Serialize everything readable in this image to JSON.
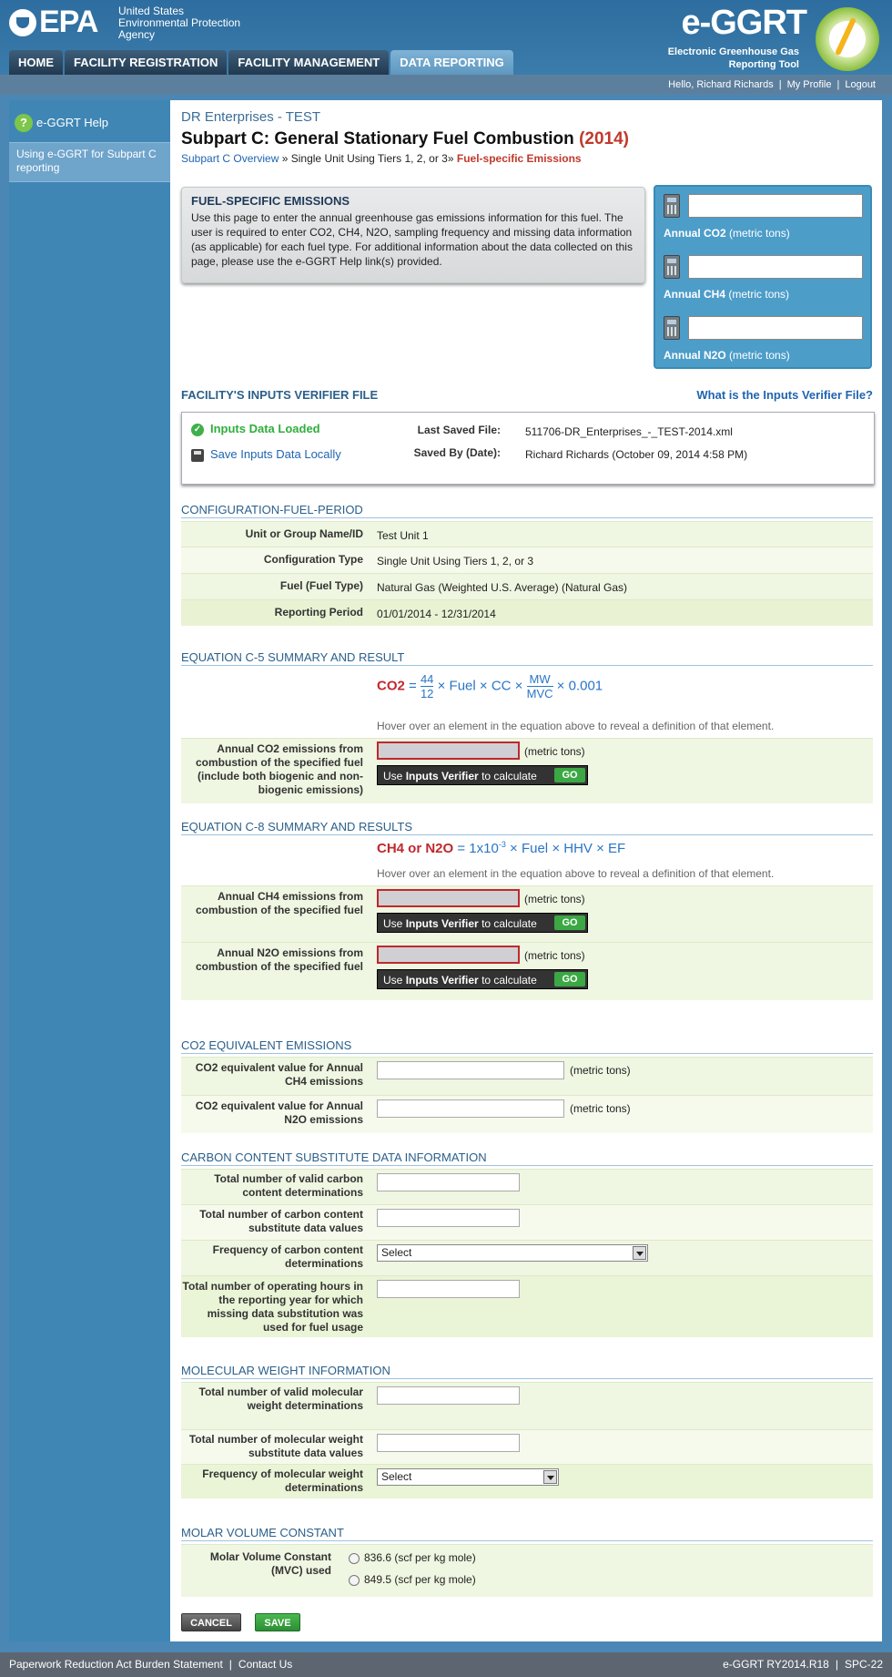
{
  "header": {
    "epa_logo": "EPA",
    "epa_sub": [
      "United States",
      "Environmental Protection",
      "Agency"
    ],
    "app_logo": "e-GGRT",
    "app_sub": [
      "Electronic Greenhouse Gas",
      "Reporting Tool"
    ],
    "tabs": [
      {
        "label": "HOME"
      },
      {
        "label": "FACILITY REGISTRATION"
      },
      {
        "label": "FACILITY MANAGEMENT"
      },
      {
        "label": "DATA REPORTING",
        "active": true
      }
    ],
    "user": {
      "greeting": "Hello, Richard Richards",
      "profile": "My Profile",
      "logout": "Logout"
    }
  },
  "sidebar": {
    "help_label": "e-GGRT Help",
    "link_label": "Using e-GGRT for Subpart C reporting"
  },
  "page": {
    "org": "DR Enterprises - TEST",
    "title": "Subpart C: General Stationary Fuel Combustion",
    "year": "(2014)",
    "breadcrumb": {
      "link": "Subpart C Overview",
      "sep1": "»",
      "mid": "Single Unit Using Tiers 1, 2, or 3",
      "sep2": "»",
      "current": "Fuel-specific Emissions"
    }
  },
  "info": {
    "title": "FUEL-SPECIFIC EMISSIONS",
    "text": "Use this page to enter the annual greenhouse gas emissions information for this fuel. The user is required to enter CO2, CH4, N2O, sampling frequency and missing data information (as applicable) for each fuel type. For additional information about the data collected on this page, please use the e-GGRT Help link(s) provided."
  },
  "summary": {
    "items": [
      {
        "gas": "Annual CO2",
        "unit": "(metric tons)",
        "value": ""
      },
      {
        "gas": "Annual CH4",
        "unit": "(metric tons)",
        "value": ""
      },
      {
        "gas": "Annual N2O",
        "unit": "(metric tons)",
        "value": ""
      }
    ]
  },
  "verifier": {
    "title": "FACILITY'S INPUTS VERIFIER FILE",
    "help_link": "What is the Inputs Verifier File?",
    "status": "Inputs Data Loaded",
    "save_link": "Save Inputs Data Locally",
    "last_saved_label": "Last Saved File:",
    "last_saved_value": "511706-DR_Enterprises_-_TEST-2014.xml",
    "saved_by_label": "Saved By (Date):",
    "saved_by_value": "Richard Richards (October 09, 2014 4:58 PM)"
  },
  "config": {
    "title": "CONFIGURATION-FUEL-PERIOD",
    "rows": [
      {
        "label": "Unit or Group Name/ID",
        "value": "Test Unit 1"
      },
      {
        "label": "Configuration Type",
        "value": "Single Unit Using Tiers 1, 2, or 3"
      },
      {
        "label": "Fuel (Fuel Type)",
        "value": "Natural Gas (Weighted U.S. Average) (Natural Gas)"
      },
      {
        "label": "Reporting Period",
        "value": "01/01/2014 - 12/31/2014"
      }
    ]
  },
  "eq_c5": {
    "title": "EQUATION C-5 SUMMARY AND RESULT",
    "lhs": "CO2",
    "equals": "=",
    "f1_num": "44",
    "f1_den": "12",
    "times": "×",
    "fuel": "Fuel",
    "cc": "CC",
    "f2_num": "MW",
    "f2_den": "MVC",
    "const": "0.001",
    "hint": "Hover over an element in the equation above to reveal a definition of that element.",
    "field_label": "Annual CO2 emissions from combustion of the specified fuel (include both biogenic and non-biogenic emissions)",
    "unit": "(metric tons)"
  },
  "eq_c8": {
    "title": "EQUATION C-8 SUMMARY AND RESULTS",
    "lhs": "CH4 or N2O",
    "equals": "=",
    "factor": "1x10",
    "exp": "-3",
    "fuel": "Fuel",
    "hhv": "HHV",
    "ef": "EF",
    "times": "×",
    "hint": "Hover over an element in the equation above to reveal a definition of that element.",
    "ch4_label": "Annual CH4 emissions from combustion of the specified fuel",
    "n2o_label": "Annual N2O emissions from combustion of the specified fuel",
    "unit": "(metric tons)"
  },
  "verifier_tip": {
    "prefix": "Use",
    "bold": "Inputs Verifier",
    "suffix": "to calculate",
    "go": "GO"
  },
  "co2e": {
    "title": "CO2 EQUIVALENT EMISSIONS",
    "ch4_label": "CO2 equivalent value for Annual CH4 emissions",
    "n2o_label": "CO2 equivalent value for Annual N2O emissions",
    "unit": "(metric tons)"
  },
  "carbon": {
    "title": "CARBON CONTENT SUBSTITUTE DATA INFORMATION",
    "valid_label": "Total number of valid carbon content determinations",
    "subst_label": "Total number of carbon content substitute data values",
    "freq_label": "Frequency of carbon content determinations",
    "freq_value": "Select",
    "hours_label": "Total number of operating hours in the reporting year for which missing data substitution was used for fuel usage"
  },
  "molecular": {
    "title": "MOLECULAR WEIGHT INFORMATION",
    "valid_label": "Total number of valid molecular weight determinations",
    "subst_label": "Total number of molecular weight substitute data values",
    "freq_label": "Frequency of molecular weight determinations",
    "freq_value": "Select"
  },
  "molar": {
    "title": "MOLAR VOLUME CONSTANT",
    "label": "Molar Volume Constant (MVC) used",
    "opt1": "836.6 (scf per kg mole)",
    "opt2": "849.5 (scf per kg mole)"
  },
  "buttons": {
    "cancel": "CANCEL",
    "save": "SAVE"
  },
  "footer": {
    "paperwork": "Paperwork Reduction Act Burden Statement",
    "contact": "Contact Us",
    "version": "e-GGRT RY2014.R18",
    "page_id": "SPC-22"
  }
}
